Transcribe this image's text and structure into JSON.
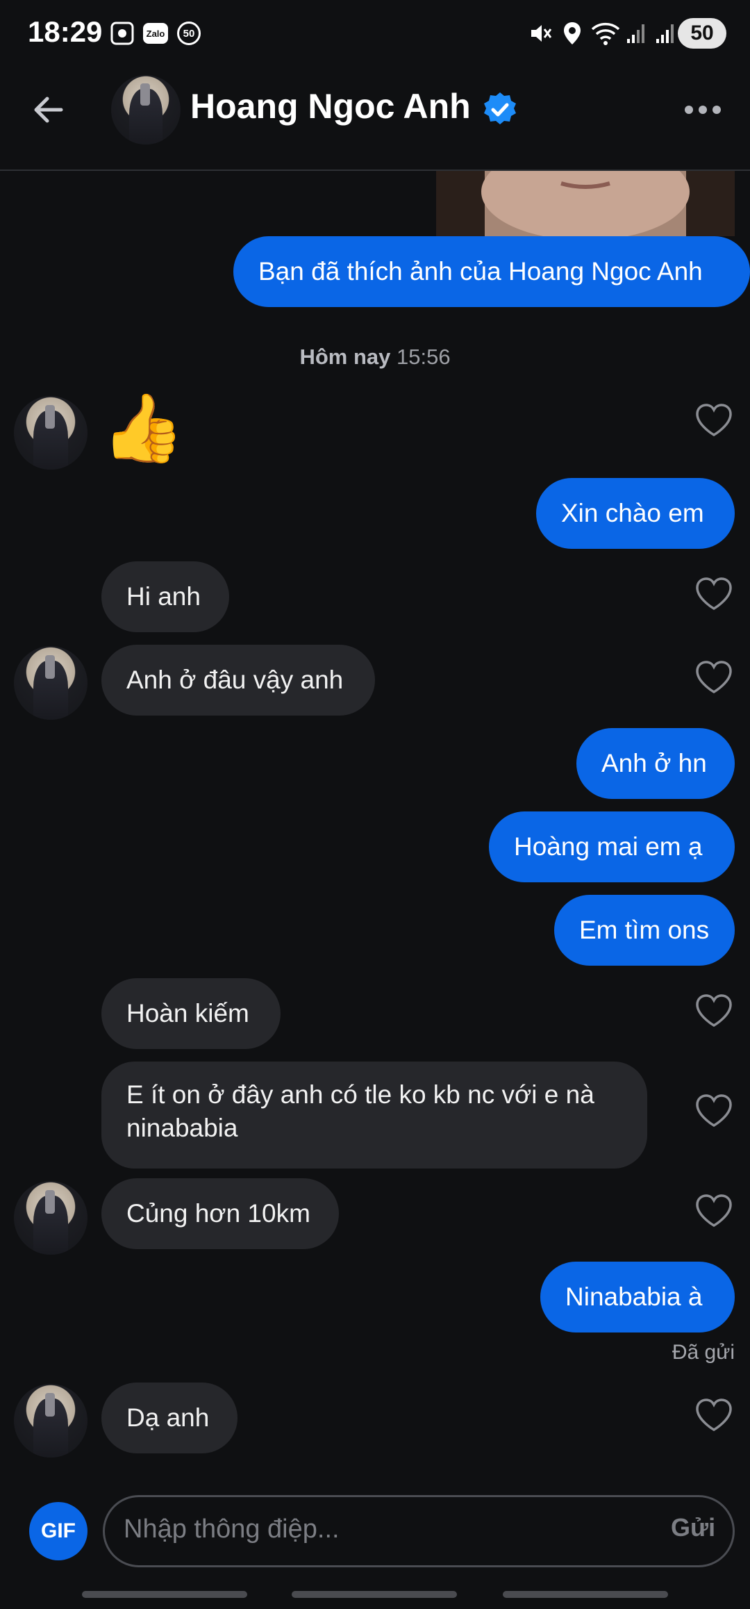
{
  "status_bar": {
    "time": "18:29",
    "icons": [
      "screenshot-icon",
      "zalo-icon",
      "badge-50-icon",
      "mute-icon",
      "location-icon",
      "wifi-icon",
      "signal-icon",
      "signal-icon"
    ],
    "zalo_label": "Zalo",
    "badge_label": "50",
    "battery": "50"
  },
  "header": {
    "contact_name": "Hoang Ngoc Anh",
    "verified": true
  },
  "messages": {
    "liked_photo": "Bạn đã thích ảnh của Hoang Ngoc Anh",
    "timestamp_day": "Hôm nay",
    "timestamp_time": "15:56",
    "thumbs_up": "👍",
    "m1": "Xin chào em",
    "m2": "Hi anh",
    "m3": "Anh ở đâu vậy anh",
    "m4": "Anh ở hn",
    "m5": "Hoàng mai em ạ",
    "m6": "Em tìm ons",
    "m7": "Hoàn kiếm",
    "m8_line1": "E ít on ở đây anh có tle ko kb nc với e nà",
    "m8_line2": "ninababia",
    "m9": "Củng hơn 10km",
    "m10": "Ninababia à",
    "sent_status": "Đã gửi",
    "m11": "Dạ anh"
  },
  "composer": {
    "gif_label": "GIF",
    "placeholder": "Nhập thông điệp...",
    "send_label": "Gửi"
  },
  "colors": {
    "background": "#0f1012",
    "outgoing_bubble": "#0a66e6",
    "incoming_bubble": "#26272b",
    "verified": "#1d8cf8"
  }
}
